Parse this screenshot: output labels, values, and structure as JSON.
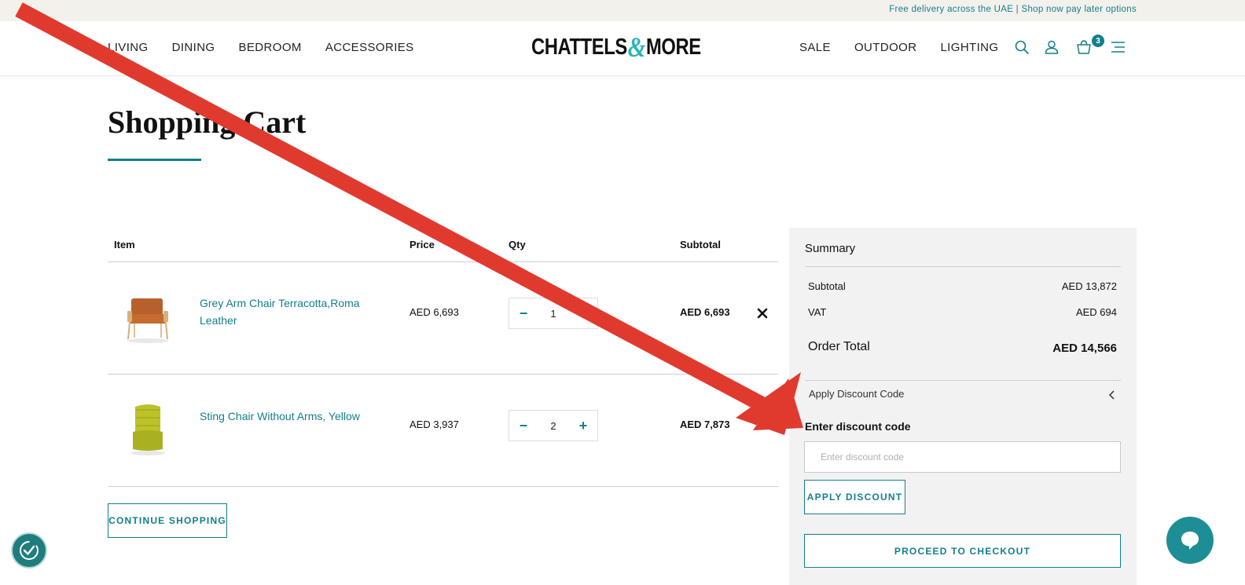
{
  "topbar": {
    "text": "Free delivery across the UAE | Shop now pay later options"
  },
  "header": {
    "logo_left": "CHATTELS",
    "logo_amp": "&",
    "logo_right": "MORE",
    "nav_left": [
      "LIVING",
      "DINING",
      "BEDROOM",
      "ACCESSORIES"
    ],
    "nav_right": [
      "SALE",
      "OUTDOOR",
      "LIGHTING"
    ],
    "cart_count": "3",
    "icons": [
      "search-icon",
      "account-icon",
      "cart-icon",
      "menu-icon"
    ]
  },
  "page": {
    "title": "Shopping Cart"
  },
  "cart": {
    "headers": {
      "item": "Item",
      "price": "Price",
      "qty": "Qty",
      "subtotal": "Subtotal"
    },
    "items": [
      {
        "name": "Grey Arm Chair Terracotta,Roma Leather",
        "price": "AED 6,693",
        "qty": "1",
        "subtotal": "AED 6,693"
      },
      {
        "name": "Sting Chair Without Arms, Yellow",
        "price": "AED 3,937",
        "qty": "2",
        "subtotal": "AED 7,873"
      }
    ],
    "continue_label": "CONTINUE SHOPPING"
  },
  "summary": {
    "title": "Summary",
    "subtotal_label": "Subtotal",
    "subtotal_value": "AED 13,872",
    "vat_label": "VAT",
    "vat_value": "AED 694",
    "order_total_label": "Order Total",
    "order_total_value": "AED 14,566",
    "discount_toggle": "Apply Discount Code",
    "discount_heading": "Enter discount code",
    "discount_placeholder": "Enter discount code",
    "discount_value": "",
    "apply_label": "APPLY DISCOUNT",
    "checkout_label": "PROCEED TO CHECKOUT"
  },
  "colors": {
    "accent": "#137f8a",
    "annotation_arrow": "#e03a2f",
    "summary_bg": "#f2f2f2"
  }
}
